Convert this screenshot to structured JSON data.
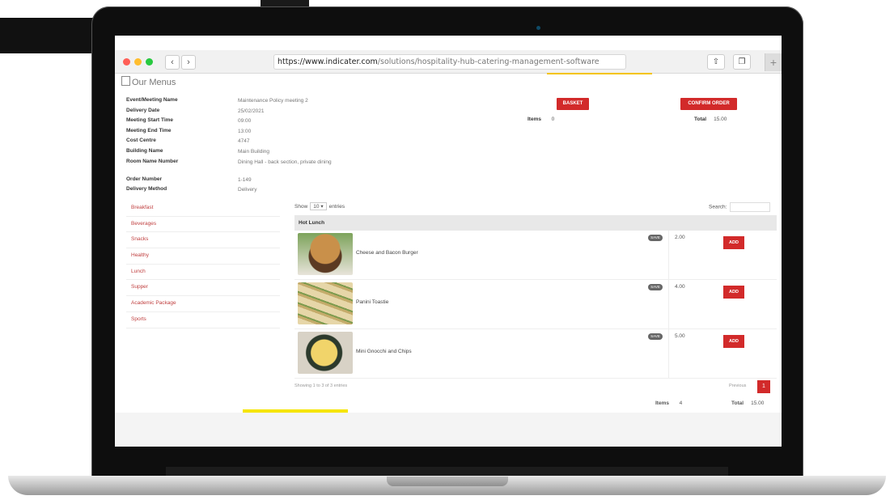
{
  "browser": {
    "url_host": "https://www.indicater.com",
    "url_path": "/solutions/hospitality-hub-catering-management-software",
    "back_glyph": "‹",
    "forward_glyph": "›",
    "share_icon": "share-icon",
    "tabs_icon": "tabs-icon",
    "new_tab_glyph": "+"
  },
  "colors": {
    "accent": "#d22a2a",
    "yellow": "#f6e500"
  },
  "page": {
    "title": "Our Menus"
  },
  "details": [
    {
      "label": "Event/Meeting Name",
      "value": "Maintenance Policy meeting 2"
    },
    {
      "label": "Delivery Date",
      "value": "25/02/2021"
    },
    {
      "label": "Meeting Start Time",
      "value": "09:00"
    },
    {
      "label": "Meeting End Time",
      "value": "13:00"
    },
    {
      "label": "Cost Centre",
      "value": "4747"
    },
    {
      "label": "Building Name",
      "value": "Main Building"
    },
    {
      "label": "Room Name Number",
      "value": "Dining Hall - back section, private dining"
    },
    {
      "label": "Order Number",
      "value": "1-149"
    },
    {
      "label": "Delivery Method",
      "value": "Delivery"
    }
  ],
  "actions": {
    "basket": "BASKET",
    "confirm": "CONFIRM ORDER"
  },
  "summary": {
    "items_label": "Items",
    "items_value": "0",
    "total_label": "Total",
    "total_value": "15.00"
  },
  "sidebar": {
    "items": [
      "Breakfast",
      "Beverages",
      "Snacks",
      "Healthy",
      "Lunch",
      "Supper",
      "Academic Package",
      "Sports"
    ]
  },
  "table": {
    "show_label": "Show",
    "show_value": "10",
    "entries_label": "entries",
    "search_label": "Search:",
    "group": "Hot Lunch",
    "rows": [
      {
        "name": "Cheese and Bacon Burger",
        "badge": "SAVE",
        "price": "2.00",
        "add": "ADD"
      },
      {
        "name": "Panini Toastie",
        "badge": "SAVE",
        "price": "4.00",
        "add": "ADD"
      },
      {
        "name": "Mini Gnocchi and Chips",
        "badge": "SAVE",
        "price": "5.00",
        "add": "ADD"
      }
    ],
    "showing": "Showing 1 to 3 of 3 entries",
    "previous": "Previous",
    "page": "1"
  },
  "bottom_summary": {
    "items_label": "Items",
    "items_value": "4",
    "total_label": "Total",
    "total_value": "15.00"
  }
}
